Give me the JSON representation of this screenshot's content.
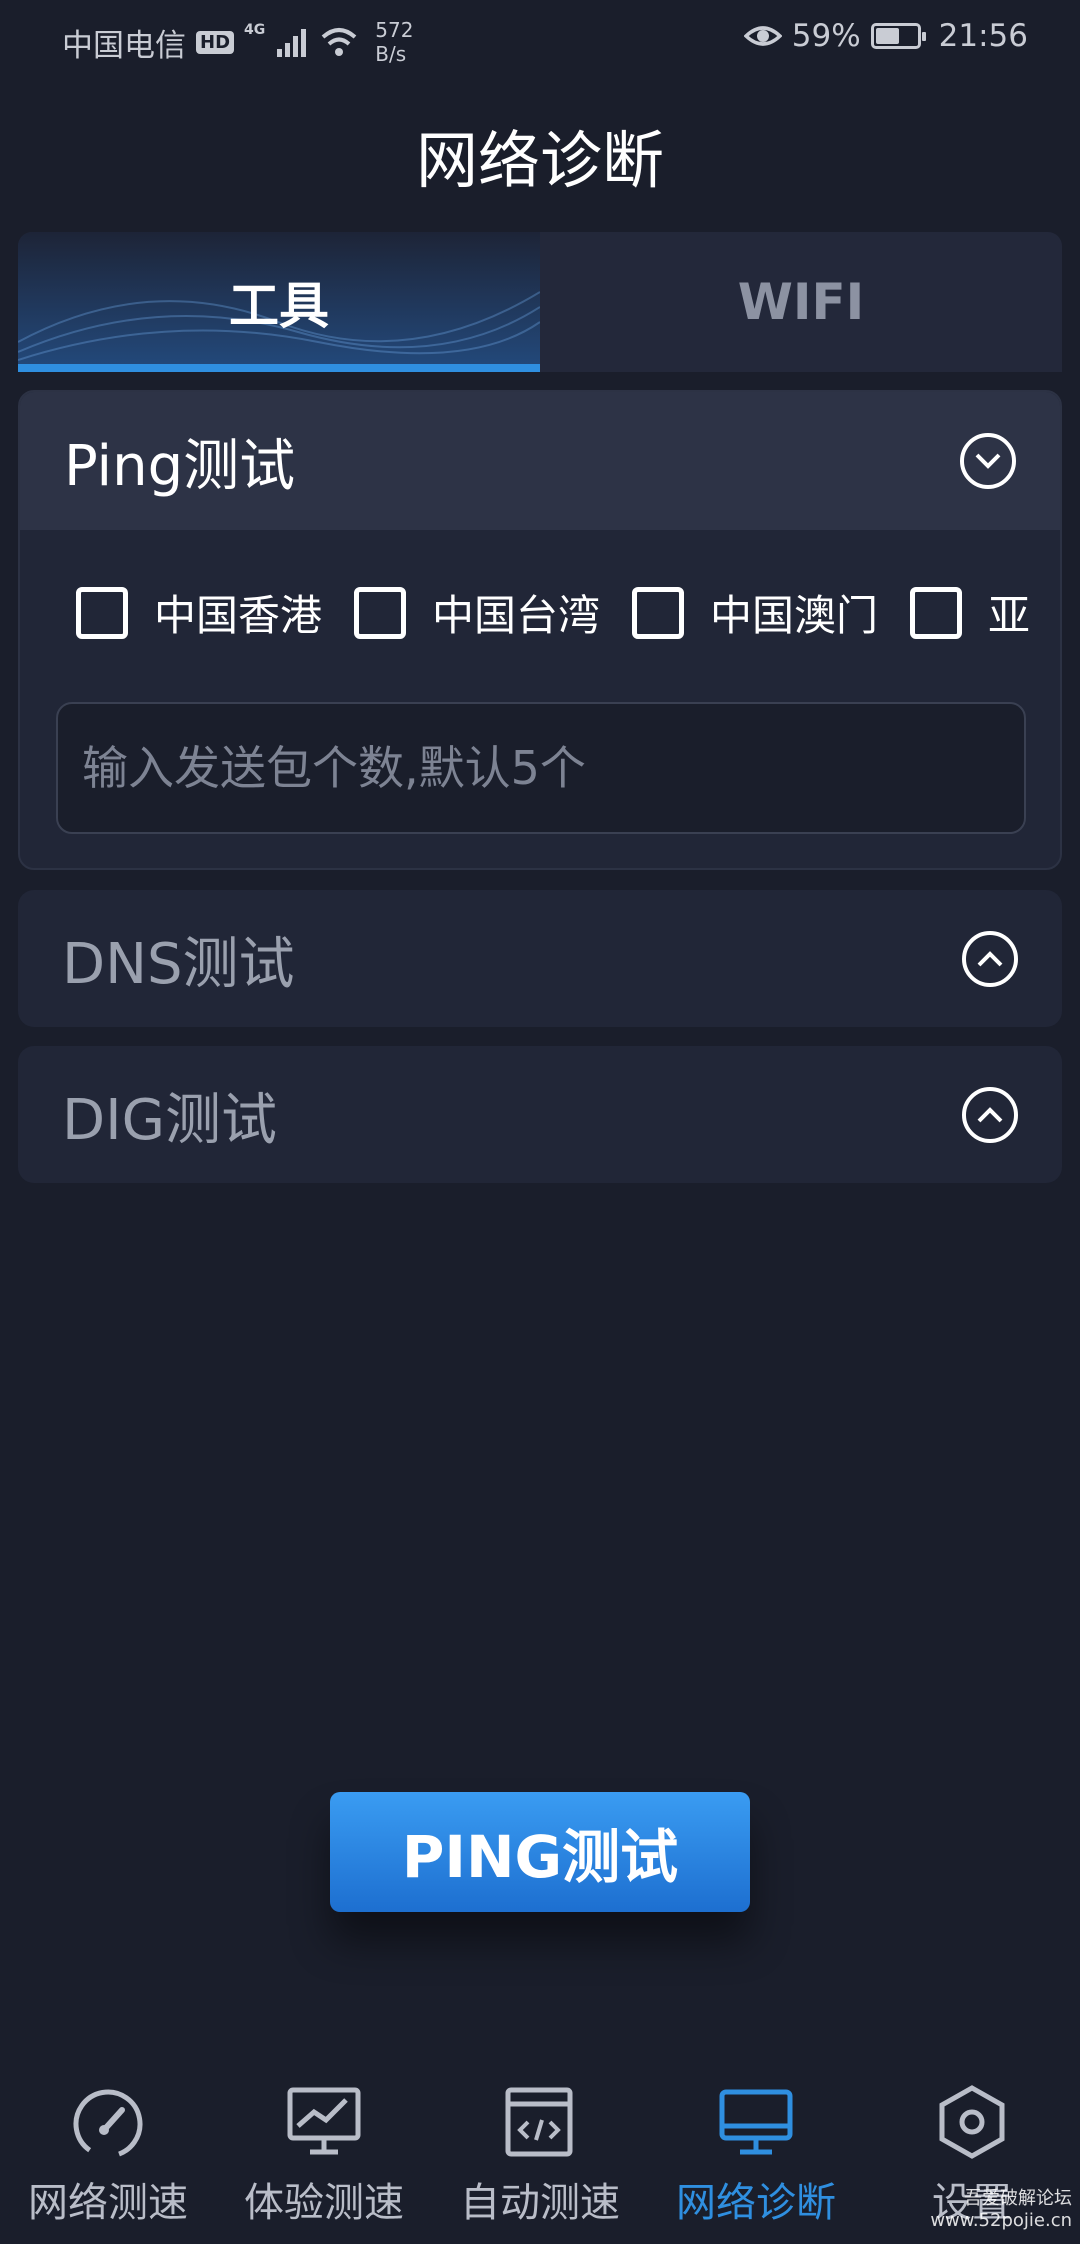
{
  "status_bar": {
    "carrier": "中国电信",
    "hd": "HD",
    "network": "4G",
    "speed_value": "572",
    "speed_unit": "B/s",
    "battery_percent": "59%",
    "battery_level": 0.59,
    "time": "21:56"
  },
  "page_title": "网络诊断",
  "tabs": [
    {
      "label": "工具",
      "active": true
    },
    {
      "label": "WIFI",
      "active": false
    }
  ],
  "ping_section": {
    "title": "Ping测试",
    "expanded": true,
    "regions": [
      "中国香港",
      "中国台湾",
      "中国澳门",
      "亚"
    ],
    "count_input": {
      "value": "",
      "placeholder": "输入发送包个数,默认5个"
    }
  },
  "dns_section": {
    "title": "DNS测试",
    "expanded": false
  },
  "dig_section": {
    "title": "DIG测试",
    "expanded": false
  },
  "action_button": "PING测试",
  "bottom_nav": [
    {
      "label": "网络测速",
      "icon": "speedometer-icon",
      "active": false
    },
    {
      "label": "体验测速",
      "icon": "monitor-chart-icon",
      "active": false
    },
    {
      "label": "自动测速",
      "icon": "code-window-icon",
      "active": false
    },
    {
      "label": "网络诊断",
      "icon": "desktop-icon",
      "active": true
    },
    {
      "label": "设置",
      "icon": "hexagon-settings-icon",
      "active": false
    }
  ],
  "watermark": {
    "line1": "吾爱破解论坛",
    "line2": "www.52pojie.cn"
  },
  "colors": {
    "background": "#1a1e2b",
    "accent": "#2f8fe0",
    "card": "#212637"
  }
}
